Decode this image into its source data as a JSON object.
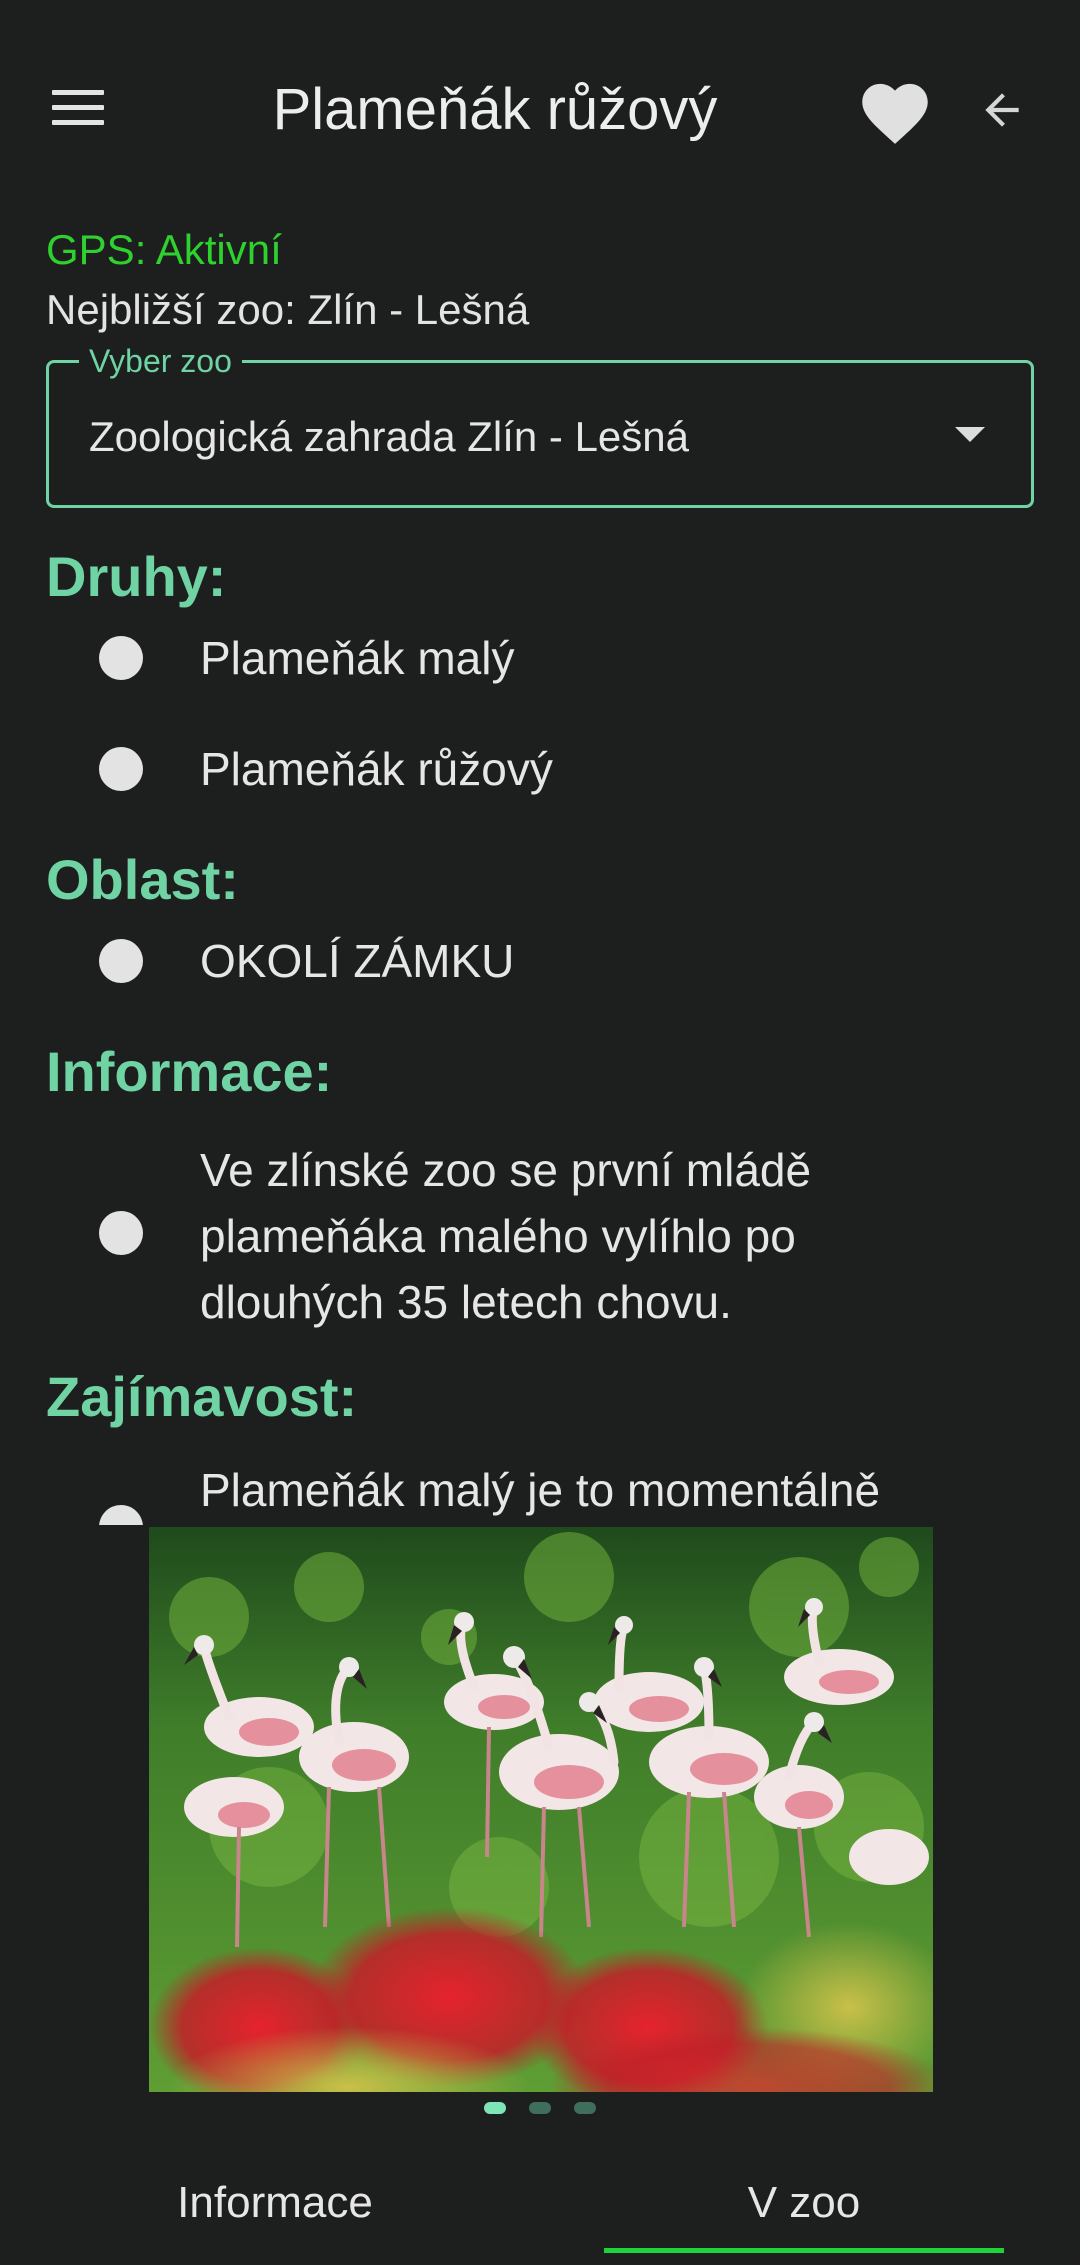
{
  "appbar": {
    "title": "Plameňák růžový",
    "menu_icon": "hamburger-menu-icon",
    "favorite_icon": "heart-icon",
    "back_icon": "arrow-left-icon"
  },
  "status": {
    "gps": "GPS: Aktivní",
    "nearest_zoo": "Nejbližší zoo: Zlín - Lešná"
  },
  "zoo_select": {
    "label": "Vyber zoo",
    "value": "Zoologická zahrada Zlín - Lešná"
  },
  "sections": {
    "species": {
      "title": "Druhy:",
      "items": [
        "Plameňák malý",
        "Plameňák růžový"
      ]
    },
    "area": {
      "title": "Oblast:",
      "items": [
        "OKOLÍ ZÁMKU"
      ]
    },
    "info": {
      "title": "Informace:",
      "items": [
        "Ve zlínské zoo se první mládě plameňáka malého vylíhlo po dlouhých 35 letech chovu."
      ]
    },
    "trivia": {
      "title": "Zajímavost:",
      "items": [
        "Plameňák malý je to momentálně"
      ]
    }
  },
  "carousel": {
    "pages": 3,
    "active_page": 1
  },
  "tabs": {
    "items": [
      "Informace",
      "V zoo"
    ],
    "active": "V zoo"
  },
  "colors": {
    "background": "#1d1f1e",
    "accent": "#6fd3a3",
    "gps_active": "#2fd12f",
    "tab_indicator": "#1fd13a"
  }
}
